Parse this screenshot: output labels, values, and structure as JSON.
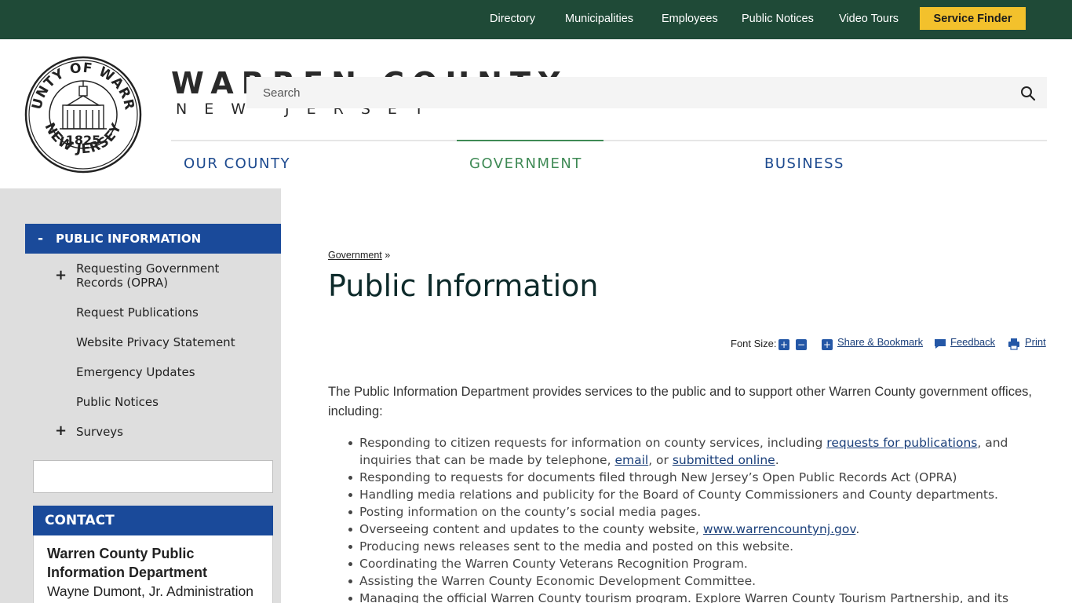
{
  "colors": {
    "topbar": "#1f4a37",
    "service_button": "#f3c12c",
    "nav_blue": "#1d4a8f",
    "nav_active_green": "#3f8a55",
    "sidebar_header_blue": "#1a4a9a",
    "sidebar_bg": "#dedede"
  },
  "topbar": {
    "links": [
      "Directory",
      "Municipalities",
      "Employees",
      "Public Notices",
      "Video Tours"
    ],
    "service_finder": "Service Finder"
  },
  "seal": {
    "top_text": "COUNTY OF WARREN",
    "bottom_text": "NEW JERSEY",
    "year": "1825"
  },
  "wordmark": {
    "title": "WARREN COUNTY",
    "subtitle": "NEW JERSEY"
  },
  "search": {
    "placeholder": "Search",
    "icon": "search-icon"
  },
  "nav": {
    "items": [
      "OUR COUNTY",
      "GOVERNMENT",
      "BUSINESS"
    ],
    "active": "GOVERNMENT"
  },
  "sidebar": {
    "header": "PUBLIC INFORMATION",
    "header_toggle": "-",
    "items": [
      {
        "label": "Requesting Government Records (OPRA)",
        "expandable": true
      },
      {
        "label": "Request Publications",
        "expandable": false
      },
      {
        "label": "Website Privacy Statement",
        "expandable": false
      },
      {
        "label": "Emergency Updates",
        "expandable": false
      },
      {
        "label": "Public Notices",
        "expandable": false
      },
      {
        "label": "Surveys",
        "expandable": true
      }
    ],
    "contact_header": "CONTACT",
    "contact_name": "Warren County Public Information Department",
    "contact_address": "Wayne Dumont, Jr. Administration"
  },
  "breadcrumb": {
    "link": "Government",
    "separator": "»"
  },
  "page_title": "Public Information",
  "toolbar": {
    "font_size_label": "Font Size:",
    "increase": "+",
    "decrease": "−",
    "share": "Share & Bookmark",
    "feedback": "Feedback",
    "print": "Print"
  },
  "content": {
    "intro": " The Public Information Department provides services to the public and to support other Warren County government offices,  including:",
    "bullets": [
      {
        "parts": [
          {
            "text": "Responding to citizen requests for information on county services, including "
          },
          {
            "text": "requests for publications",
            "link": true
          },
          {
            "text": ", and"
          }
        ]
      },
      {
        "parts": [
          {
            "text": "inquiries that can be made by telephone, "
          },
          {
            "text": "email",
            "link": true
          },
          {
            "text": ", or "
          },
          {
            "text": "submitted online",
            "link": true
          },
          {
            "text": "."
          }
        ],
        "continuation": true
      },
      {
        "parts": [
          {
            "text": "Responding to requests for documents filed through New Jersey’s Open Public Records Act (OPRA)"
          }
        ]
      },
      {
        "parts": [
          {
            "text": "Handling media relations and publicity for the Board of County Commissioners and County departments."
          }
        ]
      },
      {
        "parts": [
          {
            "text": "Posting information on the county’s social media pages."
          }
        ]
      },
      {
        "parts": [
          {
            "text": "Overseeing content and updates to the county website, "
          },
          {
            "text": "www.warrencountynj.gov",
            "link": true
          },
          {
            "text": "."
          }
        ]
      },
      {
        "parts": [
          {
            "text": "Producing news releases sent to the media and posted on this website."
          }
        ]
      },
      {
        "parts": [
          {
            "text": "Coordinating the Warren County Veterans Recognition Program."
          }
        ]
      },
      {
        "parts": [
          {
            "text": "Assisting the Warren County Economic Development Committee."
          }
        ]
      },
      {
        "parts": [
          {
            "text": "Managing the official Warren County tourism program. Explore Warren County Tourism Partnership, and its"
          }
        ]
      }
    ]
  }
}
